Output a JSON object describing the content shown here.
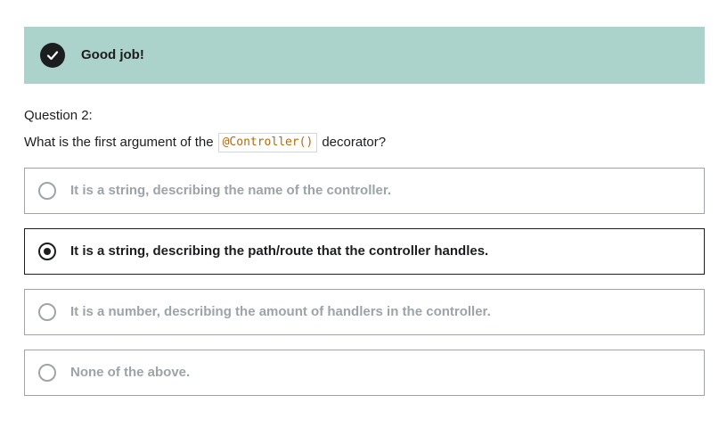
{
  "banner": {
    "icon": "checkmark-icon",
    "message": "Good job!",
    "background_color": "#acd2cc"
  },
  "question": {
    "label": "Question 2:",
    "text_before": "What is the first argument of the",
    "code": "@Controller()",
    "text_after": "decorator?"
  },
  "options": [
    {
      "label": "It is a string, describing the name of the controller.",
      "selected": false
    },
    {
      "label": "It is a string, describing the path/route that the controller handles.",
      "selected": true
    },
    {
      "label": "It is a number, describing the amount of handlers in the controller.",
      "selected": false
    },
    {
      "label": "None of the above.",
      "selected": false
    }
  ]
}
